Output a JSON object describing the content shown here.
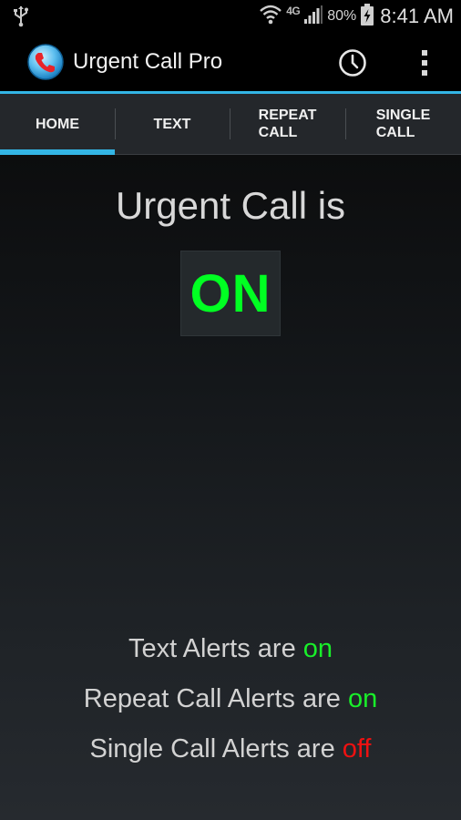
{
  "status_bar": {
    "network": "4G",
    "battery_percent": "80%",
    "time": "8:41 AM"
  },
  "action_bar": {
    "title": "Urgent Call Pro",
    "icons": [
      "app-icon",
      "history-icon",
      "overflow-menu-icon"
    ]
  },
  "tabs": [
    {
      "label": "HOME",
      "selected": true
    },
    {
      "label": "TEXT",
      "selected": false
    },
    {
      "label": "REPEAT\nCALL",
      "selected": false
    },
    {
      "label": "SINGLE\nCALL",
      "selected": false
    }
  ],
  "main": {
    "heading": "Urgent Call is",
    "state": "ON"
  },
  "alerts": [
    {
      "label": "Text Alerts are",
      "value": "on"
    },
    {
      "label": "Repeat Call Alerts are",
      "value": "on"
    },
    {
      "label": "Single Call Alerts are",
      "value": "off"
    }
  ],
  "colors": {
    "accent": "#33b5e5",
    "on": "#19ef2a",
    "off": "#ee1111"
  }
}
